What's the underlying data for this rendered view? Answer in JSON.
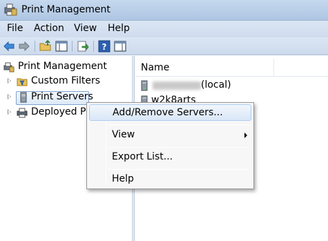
{
  "window": {
    "title": "Print Management"
  },
  "menu": {
    "file": "File",
    "action": "Action",
    "view": "View",
    "help": "Help"
  },
  "toolbar": {
    "icons": [
      "back-arrow-icon",
      "forward-arrow-icon",
      "up-folder-icon",
      "show-hide-tree-icon",
      "export-list-icon",
      "help-icon",
      "show-hide-action-pane-icon"
    ]
  },
  "tree": {
    "root": "Print Management",
    "items": [
      {
        "label": "Custom Filters"
      },
      {
        "label": "Print Servers"
      },
      {
        "label": "Deployed Pr"
      }
    ]
  },
  "list": {
    "column_name": "Name",
    "rows": [
      {
        "name_suffix": "(local)"
      },
      {
        "name": "w2k8arts"
      }
    ]
  },
  "context_menu": {
    "items": [
      {
        "label": "Add/Remove Servers..."
      },
      {
        "label": "View"
      },
      {
        "label": "Export List..."
      },
      {
        "label": "Help"
      }
    ]
  },
  "colors": {
    "titlebar": "#c5d8ee",
    "menu_hover": "#d9e7f8",
    "selection_border": "#7da2ce"
  }
}
